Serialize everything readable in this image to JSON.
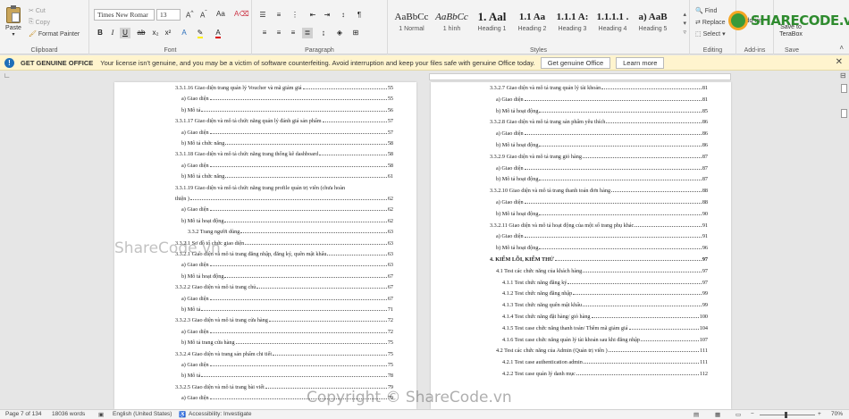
{
  "ribbon": {
    "clipboard": {
      "paste": "Paste",
      "cut": "Cut",
      "copy": "Copy",
      "format_painter": "Format Painter",
      "label": "Clipboard"
    },
    "font": {
      "name": "Times New Romar",
      "size": "13",
      "label": "Font"
    },
    "paragraph": {
      "label": "Paragraph"
    },
    "styles": {
      "label": "Styles",
      "items": [
        {
          "sample": "AaBbCc",
          "name": "1 Normal"
        },
        {
          "sample": "AaBbCc",
          "name": "1 hình"
        },
        {
          "sample": "1. Aal",
          "name": "Heading 1"
        },
        {
          "sample": "1.1 Aa",
          "name": "Heading 2"
        },
        {
          "sample": "1.1.1 A:",
          "name": "Heading 3"
        },
        {
          "sample": "1.1.1.1 .",
          "name": "Heading 4"
        },
        {
          "sample": "a) AaB",
          "name": "Heading 5"
        }
      ]
    },
    "editing": {
      "find": "Find",
      "replace": "Replace",
      "select": "Select",
      "label": "Editing"
    },
    "addins": {
      "label": "Add-ins",
      "item": "Add-ins"
    },
    "save": {
      "label": "Save",
      "item": "Save to TeraBox"
    }
  },
  "infobar": {
    "title": "GET GENUINE OFFICE",
    "message": "Your license isn't genuine, and you may be a victim of software counterfeiting. Avoid interruption and keep your files safe with genuine Office today.",
    "btn_genuine": "Get genuine Office",
    "btn_learn": "Learn more"
  },
  "left_page": [
    {
      "t": "3.3.1.16 Giao diện trang quản lý Voucher và mã giảm giá",
      "p": "55",
      "indent": 0
    },
    {
      "t": "a) Giao diện",
      "p": "55",
      "indent": 1
    },
    {
      "t": "b) Mô tả",
      "p": "56",
      "indent": 1
    },
    {
      "t": "3.3.1.17 Giao diện và mô tả chức năng quản lý đánh giá sản phẩm",
      "p": "57",
      "indent": 0
    },
    {
      "t": "a) Giao diện",
      "p": "57",
      "indent": 1
    },
    {
      "t": "b) Mô tả chức năng",
      "p": "58",
      "indent": 1
    },
    {
      "t": "3.3.1.18 Giao diện và mô tả chức năng trang thống kê dashboard",
      "p": "58",
      "indent": 0
    },
    {
      "t": "a) Giao diện",
      "p": "58",
      "indent": 1
    },
    {
      "t": "b) Mô tả chức năng",
      "p": "61",
      "indent": 1
    },
    {
      "t": "3.3.1.19 Giao diện và mô tả chức năng trang profile quản trị viên (chưa hoàn",
      "p": "",
      "indent": 0
    },
    {
      "t": "thiện )",
      "p": "62",
      "indent": 0
    },
    {
      "t": "a) Giao diện",
      "p": "62",
      "indent": 1
    },
    {
      "t": "b) Mô tả hoạt động",
      "p": "62",
      "indent": 1
    },
    {
      "t": "3.3.2 Trang người dùng",
      "p": "63",
      "indent": 2
    },
    {
      "t": "3.3.2.1 Sơ đồ tổ chức giao diện",
      "p": "63",
      "indent": 0
    },
    {
      "t": "3.3.2.1 Giao diện và mô tả trang đăng nhập, đăng ký, quên mật khẩu",
      "p": "63",
      "indent": 0
    },
    {
      "t": "a) Giao diện",
      "p": "63",
      "indent": 1
    },
    {
      "t": "b) Mô tả hoạt động",
      "p": "67",
      "indent": 1
    },
    {
      "t": "3.3.2.2 Giao diện và mô tả trang chủ",
      "p": "67",
      "indent": 0
    },
    {
      "t": "a) Giao diện",
      "p": "67",
      "indent": 1
    },
    {
      "t": "b) Mô tả",
      "p": "71",
      "indent": 1
    },
    {
      "t": "3.3.2.3 Giao diện và mô tả trang cửa hàng",
      "p": "72",
      "indent": 0
    },
    {
      "t": "a) Giao diện",
      "p": "72",
      "indent": 1
    },
    {
      "t": "b) Mô tả trang cửa hàng",
      "p": "75",
      "indent": 1
    },
    {
      "t": "3.3.2.4 Giao diện và trang sản phẩm chi tiết",
      "p": "75",
      "indent": 0
    },
    {
      "t": "a) Giao diện",
      "p": "75",
      "indent": 1
    },
    {
      "t": "b) Mô tả",
      "p": "78",
      "indent": 1
    },
    {
      "t": "3.3.2.5 Giao diện và mô tả trang bài viết",
      "p": "79",
      "indent": 0
    },
    {
      "t": "a) Giao diện",
      "p": "79",
      "indent": 1
    }
  ],
  "right_page": [
    {
      "t": "3.3.2.7 Giao diện và mô tả trang quản lý tài khoản",
      "p": "81",
      "indent": 0
    },
    {
      "t": "a) Giao diện",
      "p": "81",
      "indent": 1
    },
    {
      "t": "b) Mô tả hoạt động",
      "p": "85",
      "indent": 1
    },
    {
      "t": "3.3.2.8 Giao diện và mô tả trang sản phẩm yêu thích",
      "p": "86",
      "indent": 0
    },
    {
      "t": "a) Giao diện",
      "p": "86",
      "indent": 1
    },
    {
      "t": "b) Mô tả hoạt động",
      "p": "86",
      "indent": 1
    },
    {
      "t": "3.3.2.9 Giao diện và mô tả trang giỏ hàng",
      "p": "87",
      "indent": 0
    },
    {
      "t": "a) Giao diện",
      "p": "87",
      "indent": 1
    },
    {
      "t": "b) Mô tả hoạt động",
      "p": "87",
      "indent": 1
    },
    {
      "t": "3.3.2.10 Giao diện và mô tả trang thanh toán đơn hàng",
      "p": "88",
      "indent": 0
    },
    {
      "t": "a) Giao diện",
      "p": "88",
      "indent": 1
    },
    {
      "t": "b) Mô tả hoạt động",
      "p": "90",
      "indent": 1
    },
    {
      "t": "3.3.2.11 Giao diện và mô tả hoạt động của một số trang phụ khác",
      "p": "91",
      "indent": 0
    },
    {
      "t": "a) Giao diện",
      "p": "91",
      "indent": 1
    },
    {
      "t": "b) Mô tả hoạt động",
      "p": "96",
      "indent": 1
    },
    {
      "t": "4. KIỂM LỖI, KIỂM THỬ",
      "p": "97",
      "indent": 0,
      "bold": true
    },
    {
      "t": "4.1 Test các chức năng của khách hàng",
      "p": "97",
      "indent": 1
    },
    {
      "t": "4.1.1 Test chức năng đăng ký",
      "p": "97",
      "indent": 2
    },
    {
      "t": "4.1.2 Test chức năng đăng nhập",
      "p": "99",
      "indent": 2
    },
    {
      "t": "4.1.3 Test chức năng quên mật khẩu",
      "p": "99",
      "indent": 2
    },
    {
      "t": "4.1.4 Test chức năng đặt hàng/ giỏ hàng",
      "p": "100",
      "indent": 2
    },
    {
      "t": "4.1.5 Test case chức năng thanh toán/ Thêm mã giảm giá",
      "p": "104",
      "indent": 2
    },
    {
      "t": "4.1.6 Test case chức năng quản lý tài khoản sau khi đăng nhập",
      "p": "107",
      "indent": 2
    },
    {
      "t": "4.2 Test các chức năng của Admin (Quản trị viên )",
      "p": "111",
      "indent": 1
    },
    {
      "t": "4.2.1 Test case authentication admin",
      "p": "111",
      "indent": 2
    },
    {
      "t": "4.2.2 Test case quản lý danh mục",
      "p": "112",
      "indent": 2
    }
  ],
  "status": {
    "page": "Page 7 of 134",
    "words": "18036 words",
    "language": "English (United States)",
    "accessibility": "Accessibility: Investigate",
    "zoom": "70%"
  },
  "watermarks": {
    "logo": "SHARECODE.vn",
    "center": "ShareCode.vn",
    "copyright": "Copyright © ShareCode.vn"
  }
}
